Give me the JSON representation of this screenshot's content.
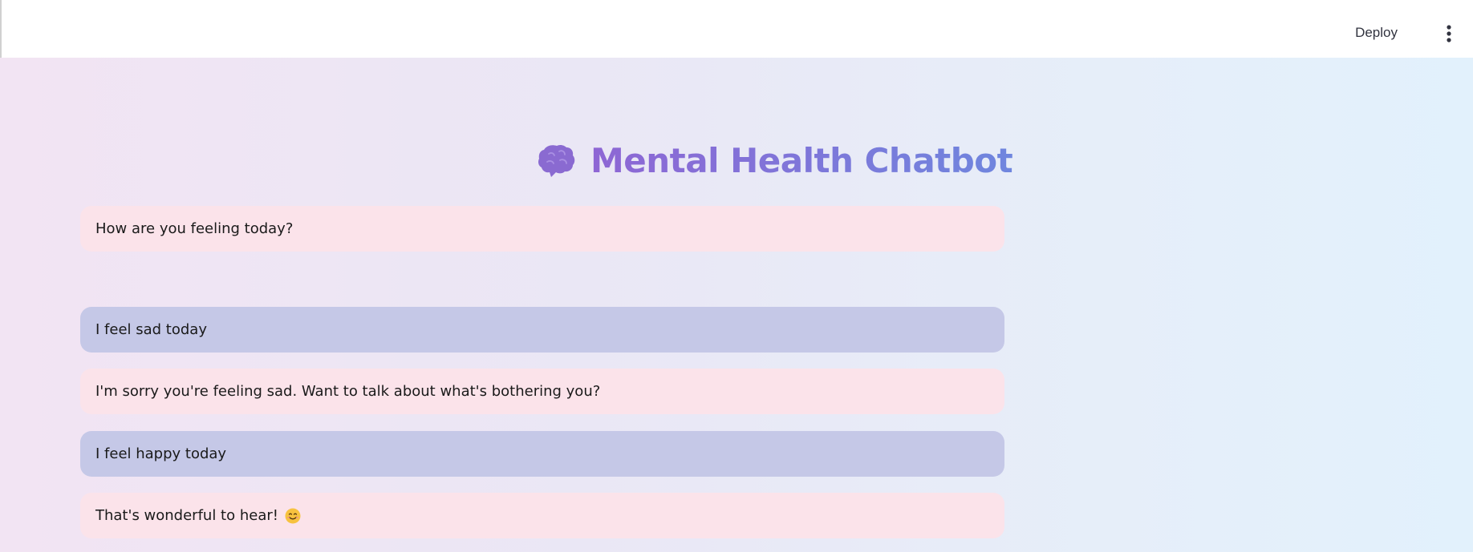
{
  "header": {
    "deploy_label": "Deploy",
    "menu_icon": "vertical-ellipsis-icon"
  },
  "main": {
    "title_icon": "brain-icon",
    "title": "Mental Health Chatbot"
  },
  "chat": {
    "messages": [
      {
        "role": "bot",
        "text": "How are you feeling today?"
      },
      {
        "role": "user",
        "text": "I feel sad today"
      },
      {
        "role": "bot",
        "text": "I'm sorry you're feeling sad. Want to talk about what's bothering you?"
      },
      {
        "role": "user",
        "text": "I feel happy today"
      },
      {
        "role": "bot",
        "text": "That's wonderful to hear!",
        "emoji": "smiling-face-icon"
      }
    ]
  },
  "colors": {
    "bot_bubble": "#fbe3ea",
    "user_bubble": "#c5c8e7",
    "title_gradient_start": "#8e66d4",
    "title_gradient_end": "#6f86de",
    "brain_icon": "#8a6ad1"
  }
}
